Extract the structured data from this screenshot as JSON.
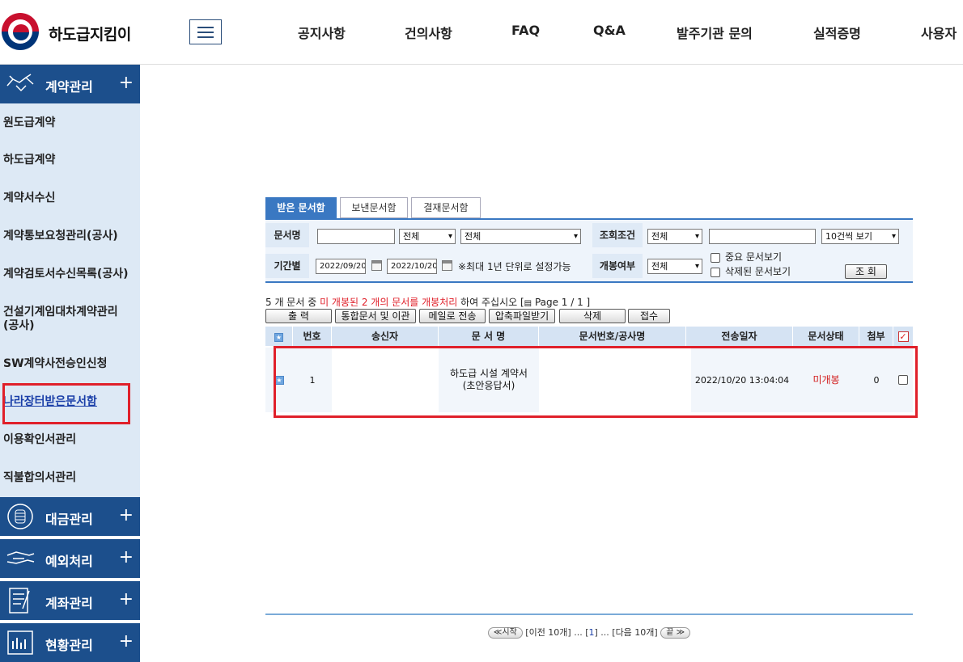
{
  "header": {
    "brand": "하도급지킴이",
    "nav": [
      "공지사항",
      "건의사항",
      "FAQ",
      "Q&A",
      "발주기관 문의",
      "실적증명",
      "사용자"
    ]
  },
  "sidebar": {
    "sections": [
      {
        "label": "계약관리",
        "icon": "handshake-icon",
        "plus": "+"
      },
      {
        "label": "대금관리",
        "icon": "coins-icon",
        "plus": "+"
      },
      {
        "label": "예외처리",
        "icon": "hand-icon",
        "plus": "+"
      },
      {
        "label": "계좌관리",
        "icon": "document-pen-icon",
        "plus": "+"
      },
      {
        "label": "현황관리",
        "icon": "chart-icon",
        "plus": "+"
      }
    ],
    "items": [
      "원도급계약",
      "하도급계약",
      "계약서수신",
      "계약통보요청관리(공사)",
      "계약검토서수신목록(공사)",
      "건설기계임대차계약관리\n(공사)",
      "SW계약사전승인신청",
      "나라장터받은문서함",
      "이용확인서관리",
      "직불합의서관리"
    ]
  },
  "tabs": [
    "받은 문서함",
    "보낸문서함",
    "결재문서함"
  ],
  "search": {
    "doc_name_label": "문서명",
    "doc_name_value": "",
    "select_all_1": "전체",
    "select_all_2": "전체",
    "cond_label": "조회조건",
    "cond_select": "전체",
    "cond_value": "",
    "page_size": "10건씩 보기",
    "period_label": "기간별",
    "date_from": "2022/09/20",
    "date_to": "2022/10/20",
    "period_note": "※최대 1년 단위로 설정가능",
    "open_label": "개봉여부",
    "open_select": "전체",
    "important_label": "중요 문서보기",
    "deleted_label": "삭제된 문서보기",
    "search_button": "조 회"
  },
  "summary": {
    "prefix": "5 개 문서 중 ",
    "highlight": "미 개봉된 2 개의 문서를 개봉처리",
    "suffix": " 하여 주십시오 [",
    "page": " Page 1 / 1 ]"
  },
  "actions": [
    "출 력",
    "통합문서 및 이관",
    "메일로 전송",
    "압축파일받기",
    "삭제",
    "접수"
  ],
  "table": {
    "headers": [
      "",
      "번호",
      "송신자",
      "문 서 명",
      "문서번호/공사명",
      "전송일자",
      "문서상태",
      "첨부",
      ""
    ],
    "rows": [
      {
        "no": "1",
        "sender": "",
        "doc_title": "하도급 시설 계약서\n(초안응답서)",
        "doc_no": "",
        "date": "2022/10/20 13:04:04",
        "status": "미개봉",
        "attach": "0"
      }
    ]
  },
  "pager": {
    "first": "≪시작",
    "prev": "[이전 10개] ... [",
    "current": "1",
    "next": "] ... [다음 10개]",
    "last": "끝 ≫"
  },
  "colors": {
    "accent": "#1c4f8c",
    "tab_active": "#3a78c2",
    "alert": "#e0202a"
  }
}
